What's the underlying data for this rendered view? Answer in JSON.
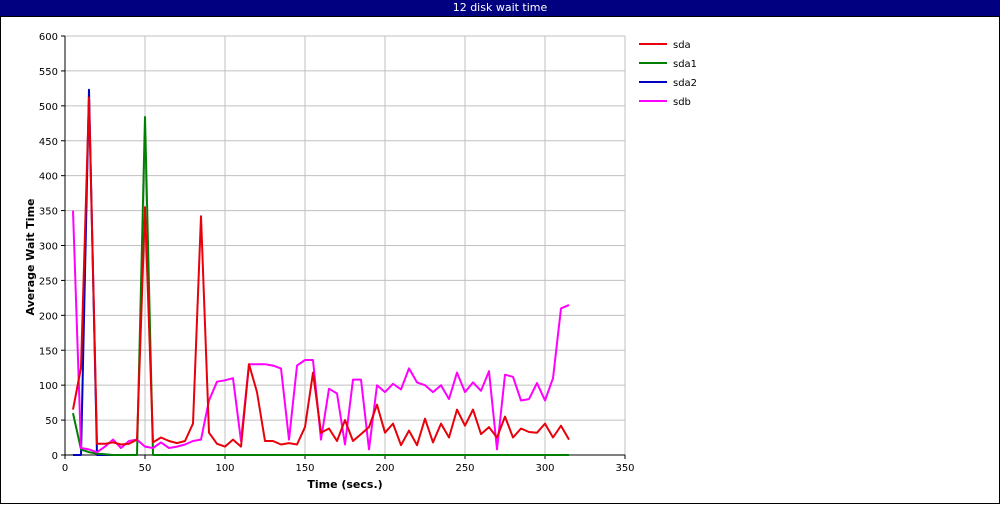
{
  "window": {
    "title": "12 disk wait time"
  },
  "colors": {
    "sda": "#e8000b",
    "sda1": "#008000",
    "sda2": "#0000c0",
    "sdb": "#ff00ff",
    "grid": "#c0c0c0",
    "titlebar": "#000080"
  },
  "chart_data": {
    "type": "line",
    "title": "12 disk wait time",
    "xlabel": "Time (secs.)",
    "ylabel": "Average Wait Time",
    "xlim": [
      0,
      350
    ],
    "ylim": [
      0,
      600
    ],
    "xticks": [
      0,
      50,
      100,
      150,
      200,
      250,
      300,
      350
    ],
    "yticks": [
      0,
      50,
      100,
      150,
      200,
      250,
      300,
      350,
      400,
      450,
      500,
      550,
      600
    ],
    "grid": true,
    "legend_position": "right",
    "series": [
      {
        "name": "sda2",
        "color": "#0000c0",
        "x": [
          5,
          10,
          15,
          20,
          25,
          30,
          35,
          40,
          45
        ],
        "y": [
          0,
          0,
          523,
          0,
          0,
          0,
          0,
          0,
          0
        ]
      },
      {
        "name": "sda1",
        "color": "#008000",
        "x": [
          5,
          10,
          15,
          20,
          25,
          30,
          35,
          40,
          45,
          50,
          55,
          60,
          70,
          80,
          90,
          100,
          150,
          200,
          250,
          300,
          315
        ],
        "y": [
          60,
          8,
          4,
          2,
          1,
          0,
          0,
          0,
          0,
          484,
          0,
          0,
          0,
          0,
          0,
          0,
          0,
          0,
          0,
          0,
          0
        ]
      },
      {
        "name": "sdb",
        "color": "#ff00ff",
        "x": [
          5,
          10,
          15,
          20,
          25,
          30,
          35,
          40,
          45,
          50,
          55,
          60,
          65,
          70,
          75,
          80,
          85,
          90,
          95,
          100,
          105,
          110,
          115,
          120,
          125,
          130,
          135,
          140,
          145,
          150,
          155,
          160,
          165,
          170,
          175,
          180,
          185,
          190,
          195,
          200,
          205,
          210,
          215,
          220,
          225,
          230,
          235,
          240,
          245,
          250,
          255,
          260,
          265,
          270,
          275,
          280,
          285,
          290,
          295,
          300,
          305,
          310,
          315
        ],
        "y": [
          350,
          10,
          8,
          4,
          12,
          22,
          10,
          20,
          22,
          12,
          10,
          18,
          10,
          12,
          15,
          20,
          22,
          78,
          105,
          107,
          110,
          20,
          130,
          130,
          130,
          128,
          124,
          22,
          128,
          136,
          136,
          22,
          95,
          88,
          15,
          108,
          108,
          8,
          100,
          90,
          102,
          94,
          124,
          104,
          100,
          90,
          100,
          80,
          118,
          90,
          104,
          92,
          120,
          8,
          115,
          112,
          78,
          80,
          103,
          78,
          110,
          210,
          215
        ]
      },
      {
        "name": "sda",
        "color": "#e8000b",
        "x": [
          5,
          10,
          15,
          20,
          25,
          30,
          35,
          40,
          45,
          50,
          55,
          60,
          65,
          70,
          75,
          80,
          85,
          90,
          95,
          100,
          105,
          110,
          115,
          120,
          125,
          130,
          135,
          140,
          145,
          150,
          155,
          160,
          165,
          170,
          175,
          180,
          185,
          190,
          195,
          200,
          205,
          210,
          215,
          220,
          225,
          230,
          235,
          240,
          245,
          250,
          255,
          260,
          265,
          270,
          275,
          280,
          285,
          290,
          295,
          300,
          305,
          310,
          315
        ],
        "y": [
          65,
          125,
          512,
          16,
          16,
          18,
          15,
          16,
          22,
          355,
          18,
          25,
          20,
          17,
          20,
          45,
          342,
          32,
          16,
          12,
          22,
          12,
          130,
          90,
          20,
          20,
          15,
          17,
          15,
          40,
          118,
          32,
          38,
          20,
          50,
          20,
          30,
          40,
          72,
          32,
          45,
          14,
          35,
          14,
          52,
          18,
          45,
          25,
          65,
          42,
          65,
          30,
          40,
          25,
          55,
          25,
          38,
          33,
          32,
          45,
          25,
          42,
          22
        ]
      }
    ],
    "legend": [
      "sda",
      "sda1",
      "sda2",
      "sdb"
    ]
  }
}
